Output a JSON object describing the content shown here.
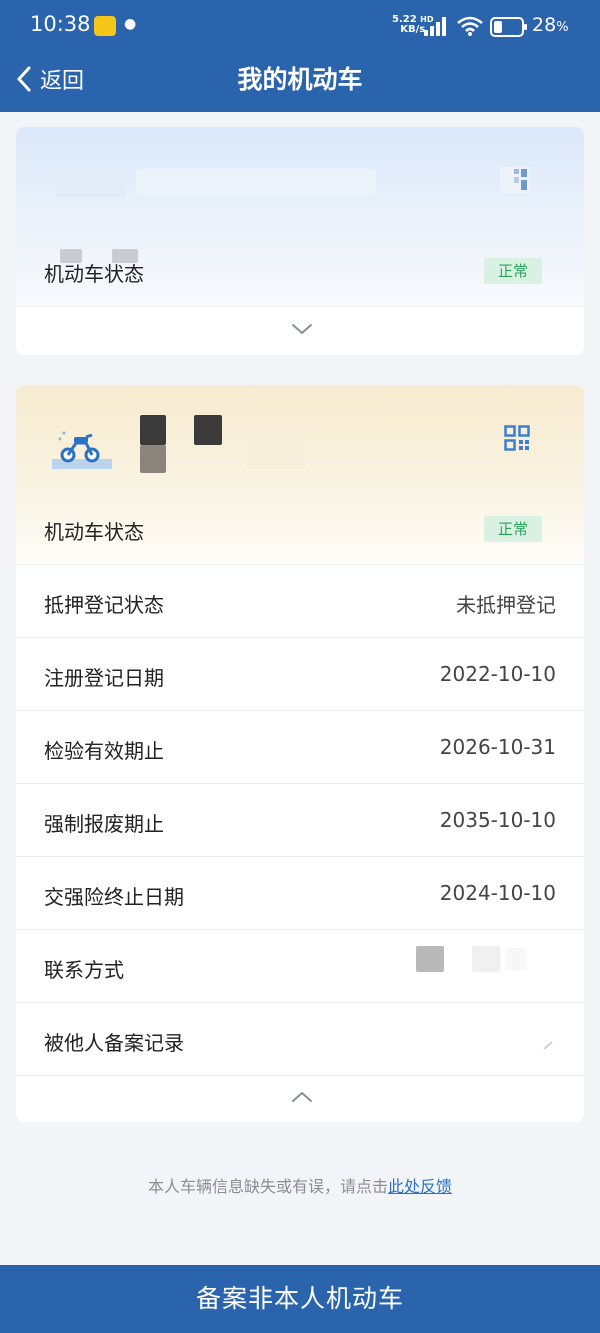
{
  "status_bar": {
    "time": "10:38",
    "net_speed": "5.22",
    "net_unit": "KB/s",
    "net_type": "HD",
    "battery": "28",
    "battery_unit": "%"
  },
  "header": {
    "back_label": "返回",
    "title": "我的机动车"
  },
  "vehicle_cards": [
    {
      "status_label": "机动车状态",
      "status_badge": "正常",
      "expanded": false
    },
    {
      "status_label": "机动车状态",
      "status_badge": "正常",
      "expanded": true,
      "rows": [
        {
          "label": "抵押登记状态",
          "value": "未抵押登记"
        },
        {
          "label": "注册登记日期",
          "value": "2022-10-10"
        },
        {
          "label": "检验有效期止",
          "value": "2026-10-31"
        },
        {
          "label": "强制报废期止",
          "value": "2035-10-10"
        },
        {
          "label": "交强险终止日期",
          "value": "2024-10-10"
        },
        {
          "label": "联系方式",
          "value": ""
        },
        {
          "label": "被他人备案记录",
          "value": ""
        }
      ]
    }
  ],
  "feedback": {
    "text": "本人车辆信息缺失或有误，请点击",
    "link": "此处反馈"
  },
  "bottom_button": "备案非本人机动车",
  "colors": {
    "primary": "#2a64ad",
    "badge_bg": "#d8f1e3",
    "badge_text": "#2fa35e",
    "link": "#2a72c5"
  }
}
